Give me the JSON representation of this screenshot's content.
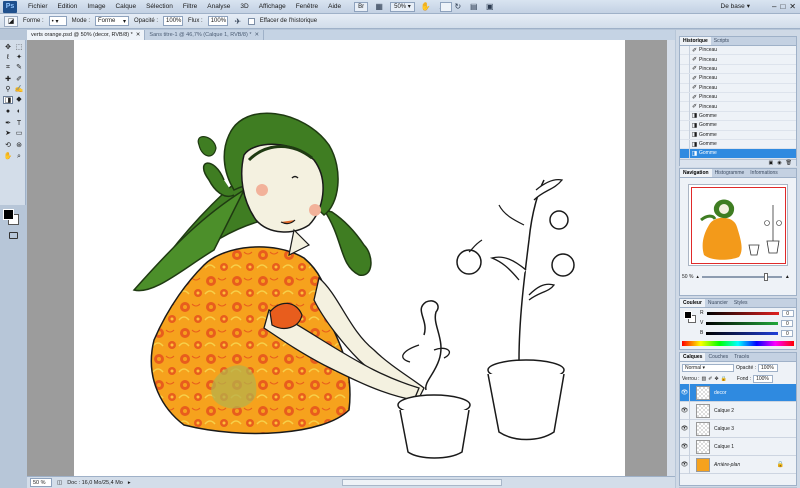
{
  "menubar": {
    "logo": "Ps",
    "items": [
      "Fichier",
      "Edition",
      "Image",
      "Calque",
      "Sélection",
      "Filtre",
      "Analyse",
      "3D",
      "Affichage",
      "Fenêtre",
      "Aide"
    ],
    "zoom": "50%",
    "workspace": "De base"
  },
  "options": {
    "forme_label": "Forme :",
    "mode_label": "Mode :",
    "mode_value": "Forme",
    "opacite_label": "Opacité :",
    "opacite_value": "100%",
    "flux_label": "Flux :",
    "flux_value": "100%",
    "effacer_label": "Effacer de l'historique"
  },
  "tabs": [
    {
      "label": "verts orange.psd @ 50% (decor, RVB/8) *",
      "active": true
    },
    {
      "label": "Sans titre-1 @ 46,7% (Calque 1, RVB/8) *",
      "active": false
    }
  ],
  "status": {
    "zoom": "50 %",
    "doc": "Doc : 16,0 Mo/25,4 Mo"
  },
  "history": {
    "tabs": [
      "Historique",
      "Scripts"
    ],
    "items": [
      "Pinceau",
      "Pinceau",
      "Pinceau",
      "Pinceau",
      "Pinceau",
      "Pinceau",
      "Pinceau",
      "Gomme",
      "Gomme",
      "Gomme",
      "Gomme",
      "Gomme"
    ],
    "icons": [
      "brush-icon",
      "brush-icon",
      "brush-icon",
      "brush-icon",
      "brush-icon",
      "brush-icon",
      "brush-icon",
      "eraser-icon",
      "eraser-icon",
      "eraser-icon",
      "eraser-icon",
      "eraser-icon"
    ],
    "selected_index": 11
  },
  "navigator": {
    "tabs": [
      "Navigation",
      "Histogramme",
      "Informations"
    ],
    "zoom": "50 %"
  },
  "color": {
    "tabs": [
      "Couleur",
      "Nuancier",
      "Styles"
    ],
    "channels": [
      {
        "label": "R",
        "value": "0",
        "color": "#e02020"
      },
      {
        "label": "V",
        "value": "0",
        "color": "#22a83a"
      },
      {
        "label": "B",
        "value": "0",
        "color": "#2040d8"
      }
    ]
  },
  "layers": {
    "tabs": [
      "Calques",
      "Couches",
      "Tracés"
    ],
    "blend_mode": "Normal",
    "opacity_label": "Opacité :",
    "opacity_value": "100%",
    "lock_label": "Verrou :",
    "fill_label": "Fond :",
    "fill_value": "100%",
    "items": [
      {
        "name": "decor",
        "selected": true
      },
      {
        "name": "Calque 2",
        "selected": false
      },
      {
        "name": "Calque 3",
        "selected": false
      },
      {
        "name": "Calque 1",
        "selected": false
      },
      {
        "name": "Arrière-plan",
        "selected": false
      }
    ]
  },
  "colors": {
    "selection": "#2f8ae0",
    "chrome": "#c3d1e3",
    "hair": "#3f7d22",
    "dress": "#f39a1a",
    "dress_flower": "#e5581c"
  }
}
